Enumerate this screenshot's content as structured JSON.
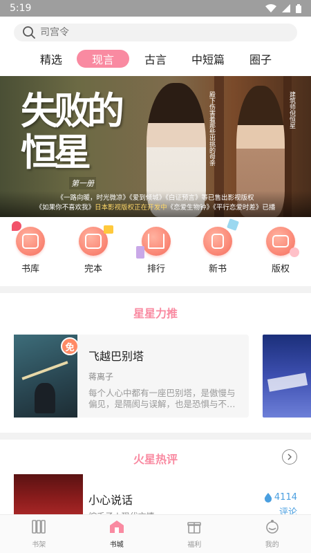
{
  "status_bar": {
    "time": "5:19"
  },
  "search": {
    "placeholder": "司宫令"
  },
  "tabs": [
    {
      "label": "精选"
    },
    {
      "label": "现言",
      "active": true
    },
    {
      "label": "古言"
    },
    {
      "label": "中短篇"
    },
    {
      "label": "圈子"
    }
  ],
  "banner": {
    "title": "失败的恒星",
    "subtitle": "第一册",
    "vertical_left": "殿下伤害着那些出挑的母亲",
    "vertical_right": "建筑师倪恒星",
    "caption_line1": "《一路向暖，时光微凉》《爱到倾城》《白证预言》等已售出影视版权",
    "caption_line2_prefix": "《如果你不喜欢我》",
    "caption_line2_em": "日本影视版权正在开发中",
    "caption_line2_suffix": "《恋爱生物钟》《平行恋爱时差》已播"
  },
  "categories": [
    {
      "label": "书库",
      "icon": "library-icon"
    },
    {
      "label": "完本",
      "icon": "completed-icon"
    },
    {
      "label": "排行",
      "icon": "ranking-icon"
    },
    {
      "label": "新书",
      "icon": "new-book-icon"
    },
    {
      "label": "版权",
      "icon": "copyright-icon"
    }
  ],
  "section_recommend": {
    "title": "星星力推",
    "book": {
      "title": "飞越巴别塔",
      "author": "蒋离子",
      "description": "每个人心中都有一座巴别塔，是傲慢与偏见，是隔阂与误解，也是恐惧与不安……",
      "badge": "免"
    }
  },
  "section_hot": {
    "title": "火星热评",
    "book": {
      "title": "小心说话",
      "subtitle": "绾禾子 | 现代言情",
      "comment_count": "4114",
      "comment_label": "评论"
    }
  },
  "bottom_nav": [
    {
      "label": "书架",
      "icon": "bookshelf-icon"
    },
    {
      "label": "书城",
      "icon": "bookstore-icon",
      "active": true
    },
    {
      "label": "福利",
      "icon": "gift-icon"
    },
    {
      "label": "我的",
      "icon": "profile-icon"
    }
  ],
  "colors": {
    "accent_pink": "#f98aa1",
    "icon_coral": "#fb8a78",
    "comment_blue": "#4a9fe0"
  }
}
